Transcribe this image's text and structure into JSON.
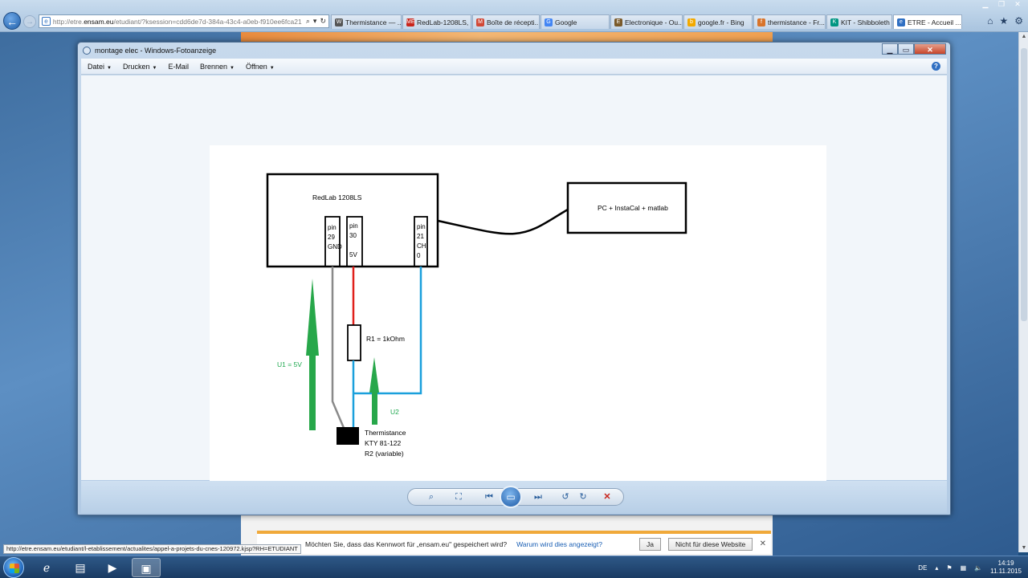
{
  "browser": {
    "url_prefix": "http://etre.",
    "url_domain": "ensam.eu",
    "url_suffix": "/etudiant/?ksession=cdd6de7d-384a-43c4-a0eb-f910ee6fca21",
    "tabs": [
      {
        "label": "Thermistance — ...",
        "icon": "W",
        "color": "#555555"
      },
      {
        "label": "RedLab-1208LS, U...",
        "icon": "ME",
        "color": "#c8241b"
      },
      {
        "label": "Boîte de récepti...",
        "icon": "M",
        "color": "#d14836"
      },
      {
        "label": "Google",
        "icon": "G",
        "color": "#4285f4"
      },
      {
        "label": "Electronique - Ou...",
        "icon": "E",
        "color": "#7a5a2a"
      },
      {
        "label": "google.fr - Bing",
        "icon": "b",
        "color": "#f2a900"
      },
      {
        "label": "thermistance - Fr...",
        "icon": "f",
        "color": "#d8742b"
      },
      {
        "label": "KIT - Shibboleth",
        "icon": "K",
        "color": "#009682"
      },
      {
        "label": "ETRE - Accueil ...",
        "icon": "e",
        "color": "#2f6fc2"
      }
    ]
  },
  "viewer": {
    "title": "montage elec - Windows-Fotoanzeige",
    "menu": [
      "Datei",
      "Drucken",
      "E-Mail",
      "Brennen",
      "Öffnen"
    ],
    "menu_has_caret": [
      true,
      true,
      false,
      true,
      true
    ]
  },
  "diagram": {
    "redlab_label": "RedLab 1208LS",
    "pc_label": "PC + InstaCal + matlab",
    "pin29": [
      "pin",
      "29",
      "GND"
    ],
    "pin30": [
      "pin",
      "30",
      "",
      "5V"
    ],
    "pin21": [
      "pin",
      "21",
      "CH",
      "0"
    ],
    "r1_label": "R1 = 1kOhm",
    "u1_label": "U1 = 5V",
    "u2_label": "U2",
    "thermistor_label": [
      "Thermistance",
      "KTY 81-122",
      "R2 (variable)"
    ],
    "colors": {
      "gnd": "#8a8a8a",
      "vcc": "#e0201b",
      "signal": "#1aa0dc",
      "voltage": "#27a74a"
    }
  },
  "notification": {
    "text": "Möchten Sie, dass das Kennwort für „ensam.eu\" gespeichert wird?",
    "link": "Warum wird dies angezeigt?",
    "yes": "Ja",
    "no": "Nicht für diese Website"
  },
  "status_url": "http://etre.ensam.eu/etudiant/l-etablissement/actualites/appel-a-projets-du-cnes-120972.kjsp?RH=ETUDIANT",
  "taskbar": {
    "lang": "DE",
    "time": "14:19",
    "date": "11.11.2015"
  }
}
